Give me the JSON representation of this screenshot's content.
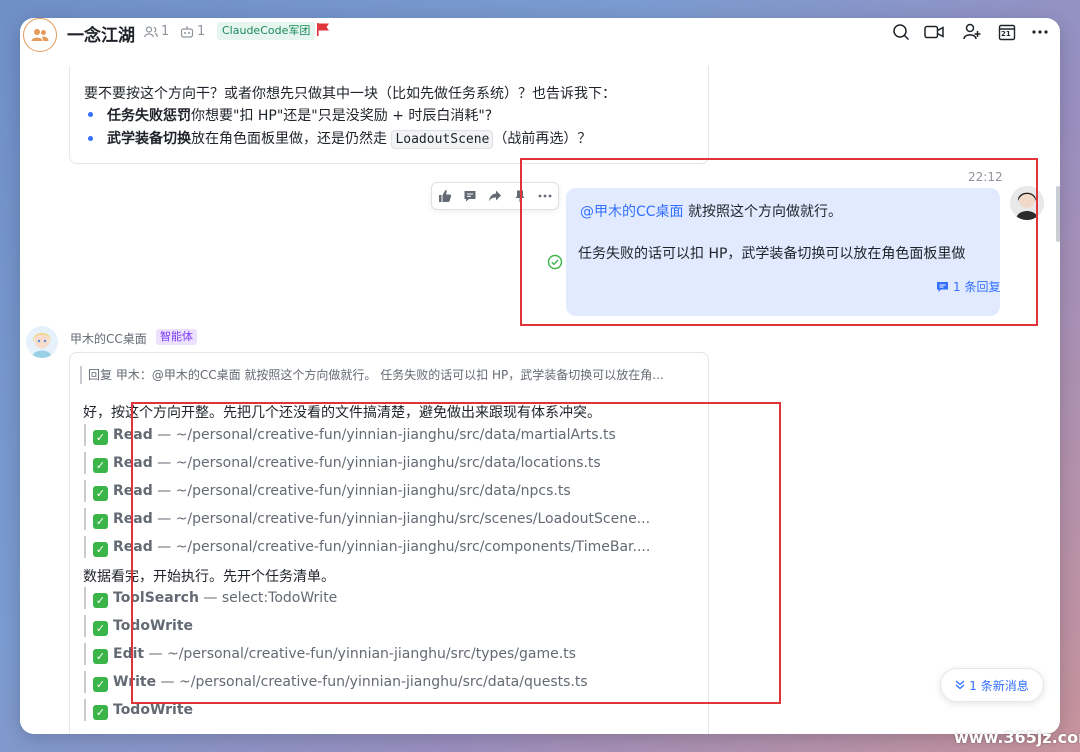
{
  "header": {
    "title": "一念江湖",
    "member_count": "1",
    "bot_count": "1",
    "tag": "ClaudeCode军团",
    "icons": [
      "search-icon",
      "video-icon",
      "add-member-icon",
      "calendar-icon",
      "more-icon"
    ],
    "calendar_day": "21"
  },
  "prev_message": {
    "line1": "要不要按这个方向干？或者你想先只做其中一块（比如先做任务系统）？也告诉我下：",
    "bullet1_bold": "任务失败惩罚",
    "bullet1_rest": "你想要\"扣 HP\"还是\"只是没奖励 + 时辰白消耗\"?",
    "bullet2_bold": "武学装备切换",
    "bullet2_mid": "放在角色面板里做，还是仍然走",
    "bullet2_code": "LoadoutScene",
    "bullet2_end": "（战前再选）？"
  },
  "user_message": {
    "time": "22:12",
    "mention": "@甲木的CC桌面",
    "line1_rest": " 就按照这个方向做就行。",
    "line2": "任务失败的话可以扣 HP，武学装备切换可以放在角色面板里做",
    "reply_count": "1 条回复",
    "action_icons": [
      "thumbs-up-icon",
      "comment-icon",
      "forward-icon",
      "flag-icon",
      "more-icon"
    ]
  },
  "bot_message": {
    "sender": "甲木的CC桌面",
    "sender_tag": "智能体",
    "quote": "回复 甲木：@甲木的CC桌面 就按照这个方向做就行。 任务失败的话可以扣 HP，武学装备切换可以放在角...",
    "intro": "好，按这个方向开整。先把几个还没看的文件搞清楚，避免做出来跟现有体系冲突。",
    "reads": [
      {
        "tool": "Read",
        "sep": " — ",
        "arg": "~/personal/creative-fun/yinnian-jianghu/src/data/martialArts.ts"
      },
      {
        "tool": "Read",
        "sep": " — ",
        "arg": "~/personal/creative-fun/yinnian-jianghu/src/data/locations.ts"
      },
      {
        "tool": "Read",
        "sep": " — ",
        "arg": "~/personal/creative-fun/yinnian-jianghu/src/data/npcs.ts"
      },
      {
        "tool": "Read",
        "sep": " — ",
        "arg": "~/personal/creative-fun/yinnian-jianghu/src/scenes/LoadoutScene..."
      },
      {
        "tool": "Read",
        "sep": " — ",
        "arg": "~/personal/creative-fun/yinnian-jianghu/src/components/TimeBar...."
      }
    ],
    "middle": "数据看完，开始执行。先开个任务清单。",
    "tools": [
      {
        "tool": "ToolSearch",
        "sep": " — ",
        "arg": "select:TodoWrite"
      },
      {
        "tool": "TodoWrite",
        "sep": "",
        "arg": ""
      },
      {
        "tool": "Edit",
        "sep": " — ",
        "arg": "~/personal/creative-fun/yinnian-jianghu/src/types/game.ts"
      },
      {
        "tool": "Write",
        "sep": " — ",
        "arg": "~/personal/creative-fun/yinnian-jianghu/src/data/quests.ts"
      },
      {
        "tool": "TodoWrite",
        "sep": "",
        "arg": ""
      }
    ]
  },
  "new_messages": "1 条新消息",
  "watermark": "www.365jz.com",
  "colors": {
    "accent": "#3370ff",
    "bubble": "#e1eaff",
    "highlight_box": "#e0343b",
    "check": "#3bb54a"
  }
}
